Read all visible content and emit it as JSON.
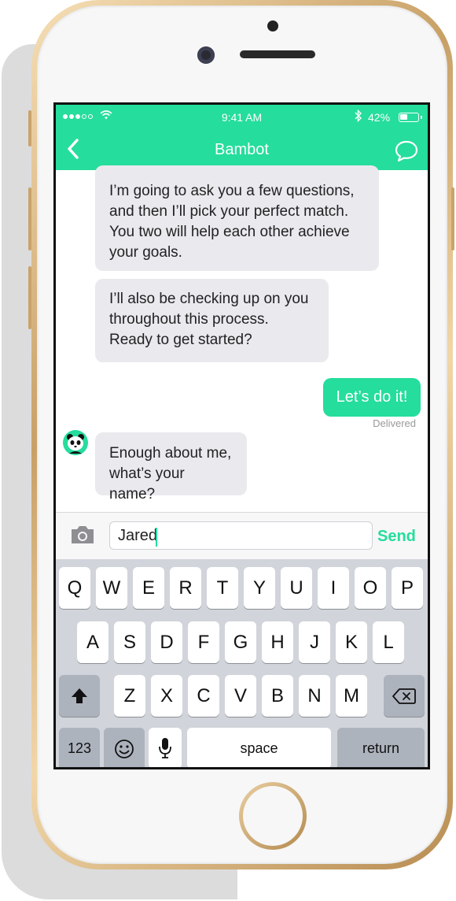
{
  "status_bar": {
    "time": "9:41 AM",
    "battery_percent": "42%",
    "battery_level": 0.42,
    "signal_bars_filled": 3,
    "signal_bars_total": 5
  },
  "nav": {
    "title": "Bambot",
    "back_icon": "chevron-left-icon",
    "chat_icon": "speech-bubble-icon"
  },
  "messages": [
    {
      "from": "bot",
      "text": "I’m going to ask you a few questions, and then I’ll pick your perfect match. You two will help each other achieve your goals."
    },
    {
      "from": "bot",
      "text": "I’ll also be checking up on you throughout this process. Ready to get started?"
    },
    {
      "from": "user",
      "text": "Let’s do it!"
    },
    {
      "from": "bot",
      "text": "Enough about me, what’s your name?"
    }
  ],
  "message_lines": {
    "m1": [
      "I’m going to ask you a few questions,",
      "and then I’ll pick your perfect match.",
      "You two will help each other achieve",
      "your goals."
    ],
    "m2": [
      "I’ll also be checking up on you",
      "throughout this process.",
      "Ready to get started?"
    ],
    "m4": [
      "Enough about me,",
      "what’s your name?"
    ]
  },
  "delivery_status": "Delivered",
  "composer": {
    "input_value": "Jared",
    "send_label": "Send",
    "camera_icon": "camera-icon"
  },
  "keyboard": {
    "row1": [
      "Q",
      "W",
      "E",
      "R",
      "T",
      "Y",
      "U",
      "I",
      "O",
      "P"
    ],
    "row2": [
      "A",
      "S",
      "D",
      "F",
      "G",
      "H",
      "J",
      "K",
      "L"
    ],
    "row3": [
      "Z",
      "X",
      "C",
      "V",
      "B",
      "N",
      "M"
    ],
    "numbers_label": "123",
    "space_label": "space",
    "return_label": "return",
    "shift_icon": "shift-icon",
    "delete_icon": "backspace-icon",
    "emoji_icon": "emoji-icon",
    "mic_icon": "microphone-icon"
  },
  "colors": {
    "accent": "#25dd9c",
    "bubble_gray": "#e9e9ee",
    "keyboard_bg": "#d1d4da",
    "phone_gold": "#c8a066"
  }
}
